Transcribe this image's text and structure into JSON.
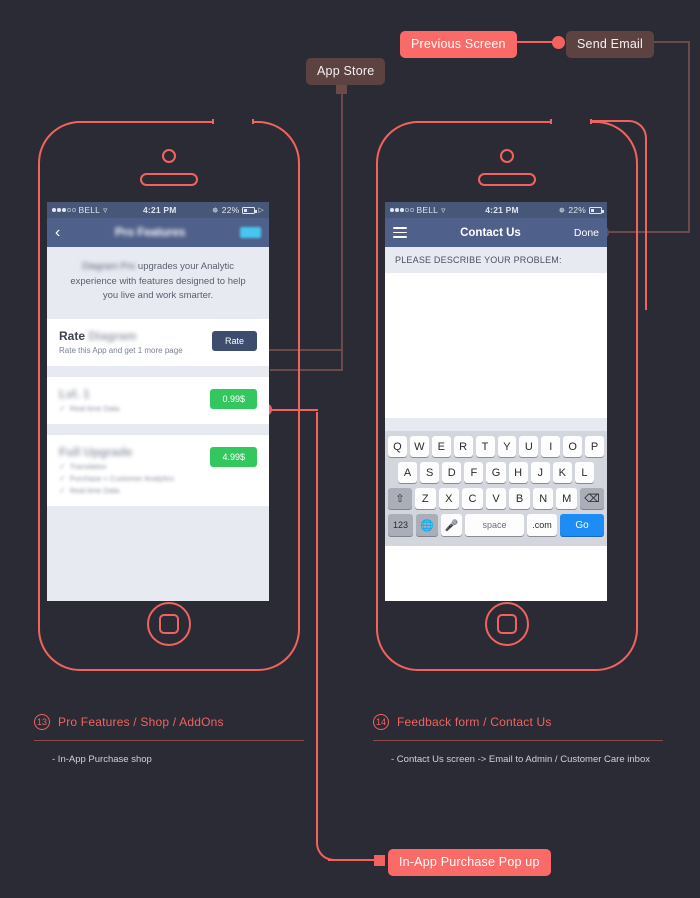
{
  "callouts": {
    "app_store": "App Store",
    "previous_screen": "Previous Screen",
    "send_email": "Send Email",
    "in_app_purchase": "In-App Purchase Pop up"
  },
  "left_phone": {
    "status": {
      "carrier": "BELL",
      "time": "4:21 PM",
      "battery": "22%"
    },
    "nav": {
      "back": "‹",
      "title": "Pro Features"
    },
    "intro": {
      "lead": "Diagram Pro",
      "text": " upgrades your Analytic experience with features designed to help you live and work smarter."
    },
    "rows": [
      {
        "title_plain": "Rate ",
        "title_blurred": "Diagram",
        "subtitle": "Rate this App and get 1 more page",
        "button": "Rate",
        "button_kind": "rate",
        "features": []
      },
      {
        "title_plain": "",
        "title_blurred": "Lvl. 1",
        "subtitle": "",
        "button": "0.99$",
        "button_kind": "price",
        "features": [
          "Real time Data"
        ]
      },
      {
        "title_plain": "",
        "title_blurred": "Full Upgrade",
        "subtitle": "",
        "button": "4.99$",
        "button_kind": "price",
        "features": [
          "Translation",
          "Purchase + Customer Analytics",
          "Real time Data"
        ]
      }
    ]
  },
  "right_phone": {
    "status": {
      "carrier": "BELL",
      "time": "4:21 PM",
      "battery": "22%"
    },
    "nav": {
      "menu": "menu-icon",
      "title": "Contact Us",
      "action": "Done"
    },
    "field_label": "PLEASE DESCRIBE YOUR PROBLEM:",
    "keyboard": {
      "row1": [
        "Q",
        "W",
        "E",
        "R",
        "T",
        "Y",
        "U",
        "I",
        "O",
        "P"
      ],
      "row2": [
        "A",
        "S",
        "D",
        "F",
        "G",
        "H",
        "J",
        "K",
        "L"
      ],
      "row3_shift": "⇧",
      "row3": [
        "Z",
        "X",
        "C",
        "V",
        "B",
        "N",
        "M"
      ],
      "row3_delete": "⌫",
      "row4_num": "123",
      "row4_globe": "ἱ0",
      "row4_mic": "Ἲ4",
      "row4_space": "space",
      "row4_dotcom": ".com",
      "row4_go": "Go"
    }
  },
  "annotations": [
    {
      "number": "13",
      "title": "Pro Features / Shop / AddOns",
      "body": "- In-App Purchase shop"
    },
    {
      "number": "14",
      "title": "Feedback form / Contact Us",
      "body": "- Contact Us screen -> Email to Admin / Customer Care inbox"
    }
  ],
  "colors": {
    "background": "#2b2b35",
    "accent": "#f2635f",
    "muted_connector": "#6b4a4a",
    "nav_blue": "#4f608a",
    "status_blue": "#465778",
    "price_green": "#33c85e",
    "rate_navy": "#3e4c6e",
    "go_blue": "#1e8cf5",
    "badge_cyan": "#46c7ef"
  }
}
